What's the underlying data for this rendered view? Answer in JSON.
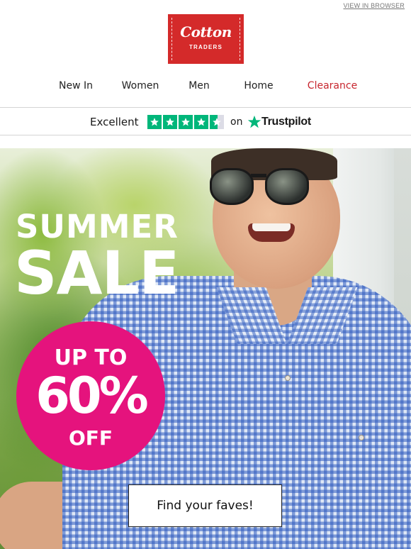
{
  "header": {
    "view_in_browser": "VIEW IN BROWSER",
    "logo": {
      "script": "Cotton",
      "sub": "TRADERS",
      "color": "#d42a2a"
    }
  },
  "nav": {
    "items": [
      {
        "label": "New In"
      },
      {
        "label": "Women"
      },
      {
        "label": "Men"
      },
      {
        "label": "Home"
      },
      {
        "label": "Clearance",
        "color": "#c7262e"
      }
    ]
  },
  "trustpilot": {
    "rating_text": "Excellent",
    "stars": 4.5,
    "on": "on",
    "brand": "Trustpilot",
    "star_color": "#00b67a"
  },
  "hero": {
    "headline_1": "SUMMER",
    "headline_2": "SALE",
    "badge": {
      "line_1": "UP TO",
      "line_2": "60%",
      "line_3": "OFF",
      "color": "#e5137d"
    },
    "cta_label": "Find your faves!"
  }
}
